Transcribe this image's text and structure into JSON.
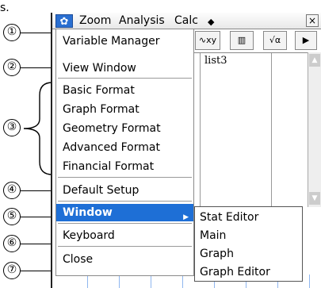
{
  "snippet_text": "s.",
  "callouts": [
    "①",
    "②",
    "③",
    "④",
    "⑤",
    "⑥",
    "⑦"
  ],
  "menubar": {
    "gear_icon": "✿",
    "items": [
      "Zoom",
      "Analysis",
      "Calc"
    ],
    "diamond": "◆",
    "close": "×"
  },
  "toolbar": {
    "buttons": [
      "∿xy",
      "▥",
      "√α",
      "▶"
    ]
  },
  "sheet": {
    "column_header": "list3"
  },
  "menu": {
    "items": [
      "Variable Manager",
      "View Window",
      "Basic Format",
      "Graph Format",
      "Geometry Format",
      "Advanced Format",
      "Financial Format",
      "Default Setup",
      "Window",
      "Keyboard",
      "Close"
    ],
    "selected_index": 8
  },
  "submenu": {
    "items": [
      "Stat Editor",
      "Main",
      "Graph",
      "Graph Editor"
    ]
  },
  "colors": {
    "selection": "#1e6fd6",
    "gear_bg": "#2a6fd1",
    "graph_lines": "#8fb6ef"
  }
}
